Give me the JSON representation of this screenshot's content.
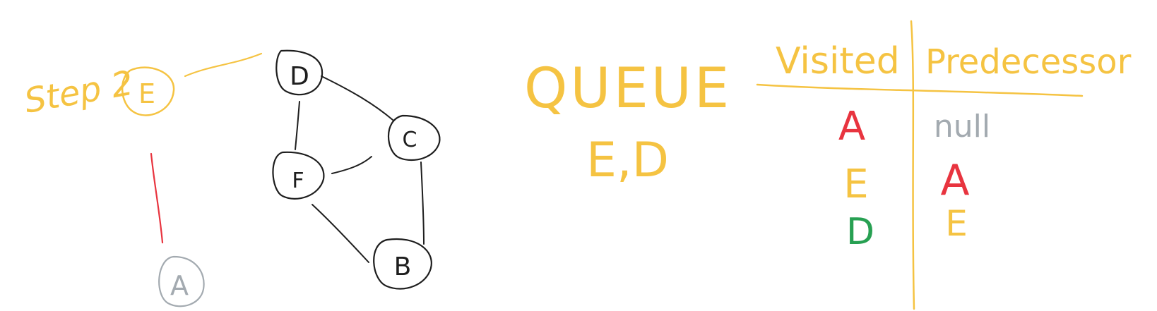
{
  "step": {
    "label": "Step 2",
    "current_node": "E"
  },
  "graph": {
    "nodes": [
      {
        "id": "D",
        "label": "D"
      },
      {
        "id": "C",
        "label": "C"
      },
      {
        "id": "F",
        "label": "F"
      },
      {
        "id": "B",
        "label": "B"
      },
      {
        "id": "A",
        "label": "A"
      }
    ],
    "edges": [
      [
        "D",
        "C"
      ],
      [
        "D",
        "F"
      ],
      [
        "F",
        "C"
      ],
      [
        "C",
        "B"
      ],
      [
        "F",
        "B"
      ],
      [
        "E",
        "D"
      ],
      [
        "E",
        "A"
      ]
    ]
  },
  "queue": {
    "title": "QUEUE",
    "contents": "E,D"
  },
  "table": {
    "header_visited": "Visited",
    "header_predecessor": "Predecessor",
    "rows": [
      {
        "visited": "A",
        "predecessor": "null"
      },
      {
        "visited": "E",
        "predecessor": "A"
      },
      {
        "visited": "D",
        "predecessor": "E"
      }
    ]
  },
  "colors": {
    "ink_black": "#1e1e1e",
    "ink_yellow": "#f5c342",
    "ink_red": "#e8343f",
    "ink_gray": "#a3aab0",
    "ink_green": "#27a052",
    "background": "#ffffff"
  }
}
